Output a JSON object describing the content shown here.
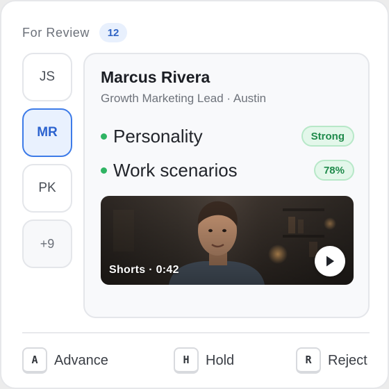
{
  "header": {
    "title": "For Review",
    "count": "12"
  },
  "avatars": [
    {
      "initials": "JS",
      "state": "default"
    },
    {
      "initials": "MR",
      "state": "active"
    },
    {
      "initials": "PK",
      "state": "default"
    },
    {
      "initials": "+9",
      "state": "more"
    }
  ],
  "candidate": {
    "name": "Marcus Rivera",
    "subtitle": "Growth Marketing Lead · Austin",
    "traits": [
      {
        "label": "Personality",
        "result": "Strong"
      },
      {
        "label": "Work scenarios",
        "result": "78%"
      }
    ],
    "video": {
      "caption": "Shorts · 0:42",
      "play_icon": "play-icon"
    }
  },
  "actions": [
    {
      "key": "A",
      "label": "Advance"
    },
    {
      "key": "H",
      "label": "Hold"
    },
    {
      "key": "R",
      "label": "Reject"
    }
  ],
  "colors": {
    "accent": "#3d7be8",
    "success": "#2fb463",
    "success_bg": "#e3f7ea"
  }
}
